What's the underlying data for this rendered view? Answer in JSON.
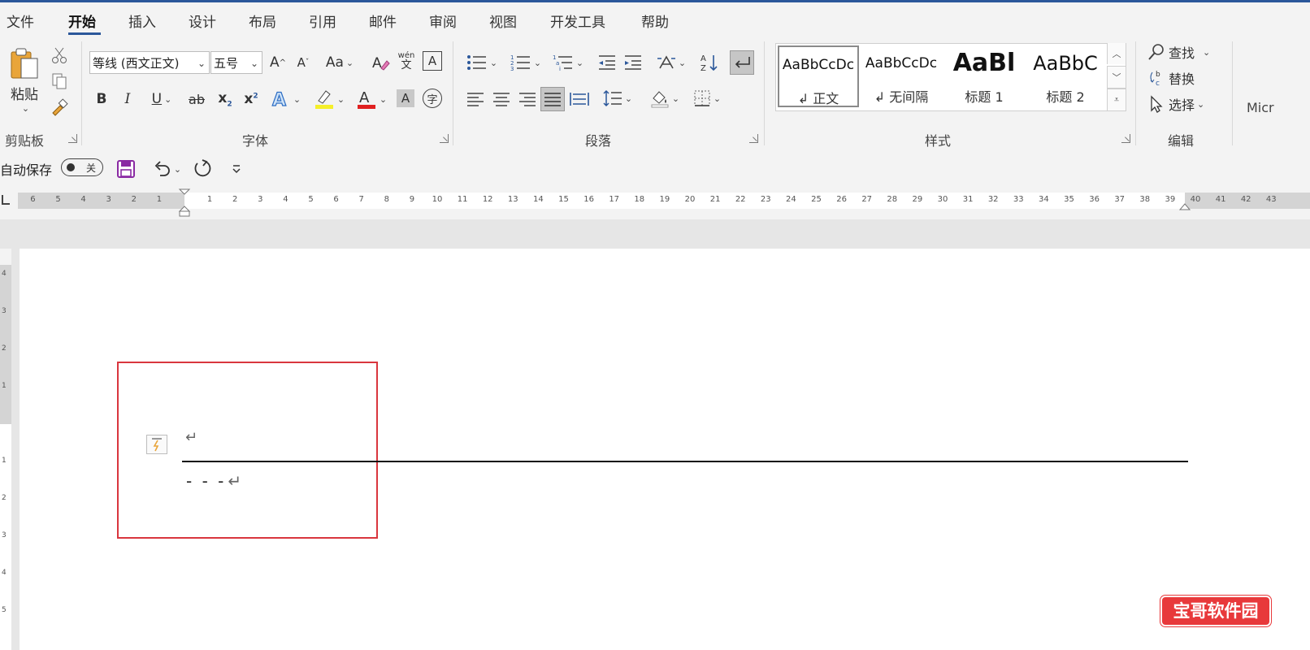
{
  "tabs": [
    "文件",
    "开始",
    "插入",
    "设计",
    "布局",
    "引用",
    "邮件",
    "审阅",
    "视图",
    "开发工具",
    "帮助"
  ],
  "active_tab": "开始",
  "clipboard": {
    "paste_label": "粘贴",
    "group_label": "剪贴板"
  },
  "font": {
    "font_name": "等线 (西文正文)",
    "font_size": "五号",
    "pinyin_top": "wén",
    "pinyin_bottom": "文",
    "group_label": "字体",
    "char_border": "A",
    "char_shading": "A",
    "enclose_char": "字",
    "bold": "B",
    "italic": "I",
    "underline": "U",
    "strike": "ab",
    "grow_font": "A",
    "shrink_font": "A",
    "change_case": "Aa",
    "highlight_color": "#f5ef2a",
    "font_color": "#e02020"
  },
  "paragraph": {
    "group_label": "段落"
  },
  "styles": {
    "group_label": "样式",
    "items": [
      {
        "sample": "AaBbCcDc",
        "name": "↲ 正文"
      },
      {
        "sample": "AaBbCcDc",
        "name": "↲ 无间隔"
      },
      {
        "sample": "AaBl",
        "name": "标题 1"
      },
      {
        "sample": "AaBbC",
        "name": "标题 2"
      }
    ]
  },
  "editing": {
    "find": "查找",
    "replace": "替换",
    "select": "选择",
    "group_label": "编辑"
  },
  "overflow_label": "Micr",
  "qat": {
    "autosave_label": "自动保存",
    "autosave_state": "关"
  },
  "ruler": {
    "left_numbers": [
      "6",
      "5",
      "4",
      "3",
      "2",
      "1"
    ],
    "right_numbers": [
      "1",
      "2",
      "3",
      "4",
      "5",
      "6",
      "7",
      "8",
      "9",
      "10",
      "11",
      "12",
      "13",
      "14",
      "15",
      "16",
      "17",
      "18",
      "19",
      "20",
      "21",
      "22",
      "23",
      "24",
      "25",
      "26",
      "27",
      "28",
      "29",
      "30",
      "31",
      "32",
      "33",
      "34",
      "35",
      "36",
      "37",
      "38",
      "39",
      "40",
      "41",
      "42",
      "43"
    ]
  },
  "vruler": {
    "numbers": [
      "4",
      "3",
      "2",
      "1",
      "1",
      "2",
      "3",
      "4",
      "5"
    ]
  },
  "document": {
    "para_mark": "↵",
    "dashes_line": "- - -",
    "highlight_color": "#d9363e"
  },
  "watermark": "宝哥软件园",
  "colors": {
    "accent": "#2b579a",
    "ribbon_bg": "#f3f3f3"
  }
}
